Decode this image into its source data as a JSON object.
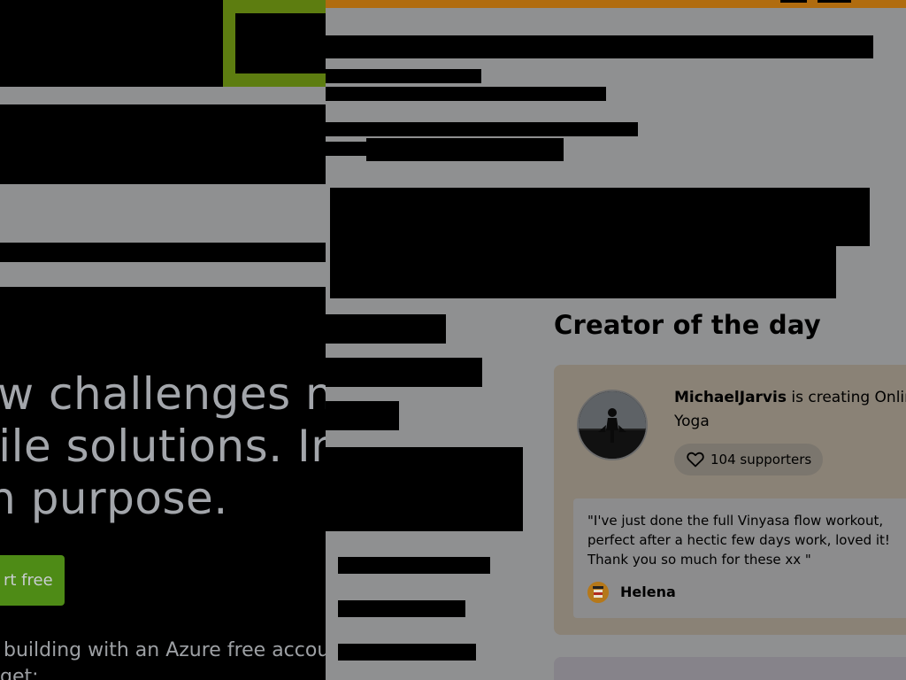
{
  "background_page": {
    "hero_lines": [
      "ew challenges n",
      "gile solutions. In",
      "th purpose."
    ],
    "start_button_label": "rt free",
    "subtext": "building with an Azure free accoun",
    "subtext_2": "get:"
  },
  "creator_of_the_day": {
    "heading": "Creator of the day",
    "creator_name": "MichaelJarvis",
    "creating_text": " is creating Online Yoga",
    "supporters_label": "104 supporters",
    "quote": "\"I've just done the full Vinyasa flow workout, perfect after a hectic few days work, loved it! Thank you so much for these xx \"",
    "quoter_name": "Helena"
  },
  "colors": {
    "accent_orange": "#b06c0f",
    "accent_green": "#4e8b16"
  }
}
